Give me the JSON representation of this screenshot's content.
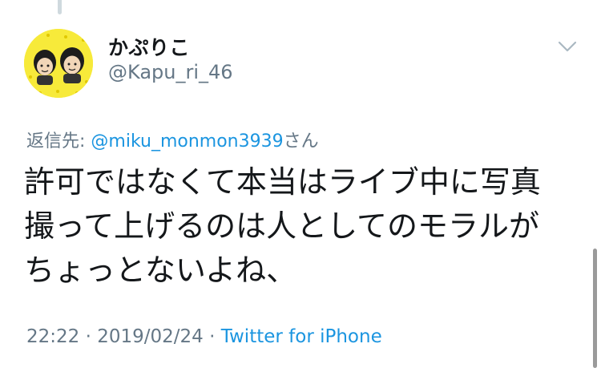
{
  "tweet": {
    "display_name": "かぷりこ",
    "handle": "@Kapu_ri_46",
    "reply_prefix": "返信先: ",
    "reply_mention": "@miku_monmon3939",
    "reply_suffix": "さん",
    "text": "許可ではなくて本当はライブ中に写真\n撮って上げるのは人としてのモラルが\nちょっとないよね、",
    "time": "22:22",
    "separator": " · ",
    "date": "2019/02/24",
    "source": "Twitter for iPhone"
  },
  "icons": {
    "menu": "chevron-down-icon",
    "avatar": "avatar"
  },
  "colors": {
    "text": "#14171a",
    "secondary": "#657786",
    "link": "#1b95e0",
    "avatar_bg": "#f7ea3a"
  }
}
